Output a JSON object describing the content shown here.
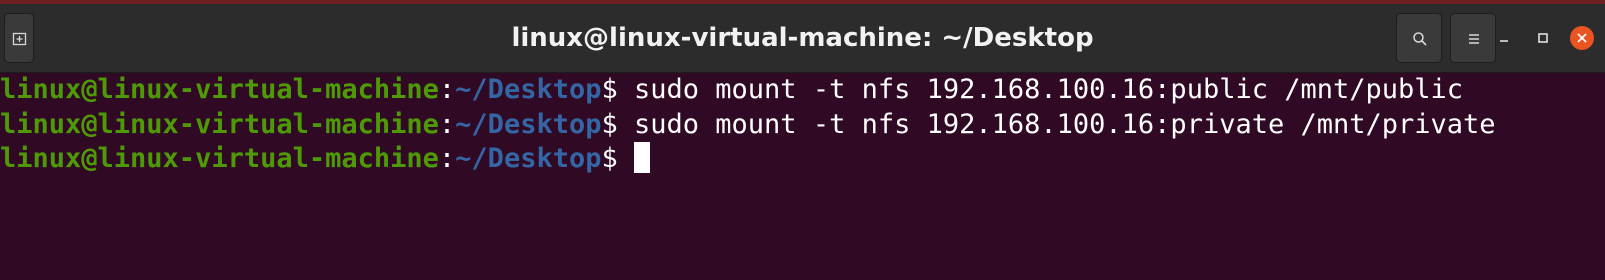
{
  "window": {
    "title": "linux@linux-virtual-machine: ~/Desktop"
  },
  "header_buttons": {
    "new_tab_icon": "new-tab-icon",
    "search_icon": "search-icon",
    "menu_icon": "hamburger-menu-icon",
    "minimize_icon": "minimize-icon",
    "maximize_icon": "maximize-icon",
    "close_icon": "close-icon"
  },
  "terminal": {
    "lines": [
      {
        "user_host": "linux@linux-virtual-machine",
        "colon": ":",
        "path": "~/Desktop",
        "dollar": "$",
        "command": " sudo mount -t nfs 192.168.100.16:public /mnt/public"
      },
      {
        "user_host": "linux@linux-virtual-machine",
        "colon": ":",
        "path": "~/Desktop",
        "dollar": "$",
        "command": " sudo mount -t nfs 192.168.100.16:private /mnt/private"
      },
      {
        "user_host": "linux@linux-virtual-machine",
        "colon": ":",
        "path": "~/Desktop",
        "dollar": "$",
        "command": " "
      }
    ]
  },
  "colors": {
    "terminal_background": "#300a24",
    "prompt_user_host": "#4e9a06",
    "prompt_path": "#3465a4",
    "titlebar": "#2c2c2c",
    "close_button": "#e95420"
  }
}
